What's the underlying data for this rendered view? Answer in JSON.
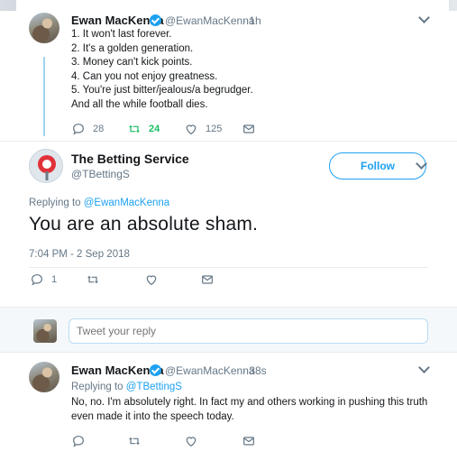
{
  "tweet1": {
    "name": "Ewan MacKenna",
    "handle": "@EwanMacKenna",
    "time": "· 1h",
    "lines": [
      "1. It won't last forever.",
      "2. It's a golden generation.",
      "3. Money can't kick points.",
      "4. Can you not enjoy greatness.",
      "5. You're just bitter/jealous/a begrudger.",
      "And all the while football dies."
    ],
    "actions": {
      "reply_count": "28",
      "retweet_count": "24",
      "like_count": "125"
    }
  },
  "tweet2": {
    "name": "The Betting Service",
    "handle": "@TBettingS",
    "follow_label": "Follow",
    "replying_prefix": "Replying to",
    "replying_handle": "@EwanMacKenna",
    "text": "You are an absolute sham.",
    "timestamp": "7:04 PM - 2 Sep 2018",
    "actions": {
      "reply_count": "1"
    }
  },
  "reply_box": {
    "placeholder": "Tweet your reply"
  },
  "tweet3": {
    "name": "Ewan MacKenna",
    "handle": "@EwanMacKenna",
    "time": "· 38s",
    "replying_prefix": "Replying to",
    "replying_handle": "@TBettingS",
    "lines": [
      "No, no. I'm absolutely right. In fact my and others working in pushing this truth",
      "even made it into the speech today."
    ]
  },
  "colors": {
    "accent": "#1da1f2",
    "retweet_green": "#17bf63",
    "muted": "#657786"
  }
}
